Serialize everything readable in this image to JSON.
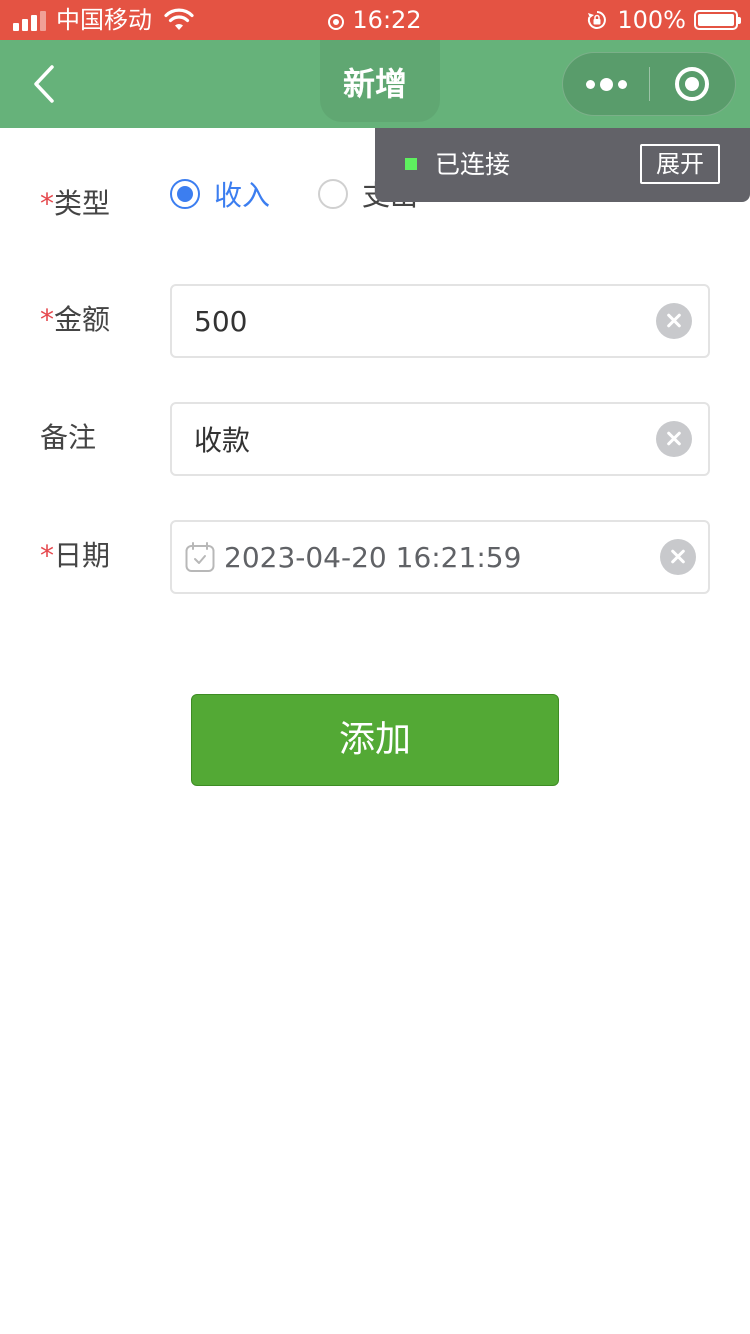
{
  "status_bar": {
    "carrier": "中国移动",
    "time": "16:22",
    "battery": "100%",
    "color": "#e45343"
  },
  "nav": {
    "title": "新增",
    "back_icon": "chevron-left-icon",
    "more_icon": "more-dots-icon",
    "close_icon": "record-circle-icon",
    "color": "#66b27a"
  },
  "toast": {
    "status": "已连接",
    "expand_label": "展开"
  },
  "form": {
    "type": {
      "required_mark": "*",
      "label": "类型",
      "options": [
        {
          "label": "收入",
          "checked": true
        },
        {
          "label": "支出",
          "checked": false
        }
      ]
    },
    "amount": {
      "required_mark": "*",
      "label": "金额",
      "value": "500"
    },
    "remark": {
      "label": "备注",
      "value": "收款"
    },
    "date": {
      "required_mark": "*",
      "label": "日期",
      "value": "2023-04-20 16:21:59"
    }
  },
  "submit": {
    "label": "添加",
    "color": "#53a935"
  }
}
